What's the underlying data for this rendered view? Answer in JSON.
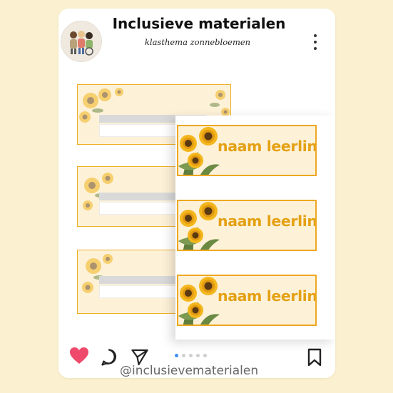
{
  "post": {
    "title": "Inclusieve materialen",
    "subtitle": "klasthema zonnebloemen",
    "handle": "@inclusievematerialen"
  },
  "labels": {
    "name_text": "naam leerling"
  },
  "carousel": {
    "pages": 5,
    "active": 1
  },
  "icons": {
    "avatar": "avatar-illustration-icon",
    "more": "more-vertical-icon",
    "like": "heart-icon",
    "comment": "comment-icon",
    "share": "send-icon",
    "save": "bookmark-icon"
  },
  "colors": {
    "background": "#fbf0cf",
    "card": "#ffffff",
    "heart": "#ef4a6b",
    "label_border": "#eda820",
    "label_text": "#e4a114",
    "label_fill": "#fdf1d8",
    "active_dot": "#3d8df5"
  }
}
